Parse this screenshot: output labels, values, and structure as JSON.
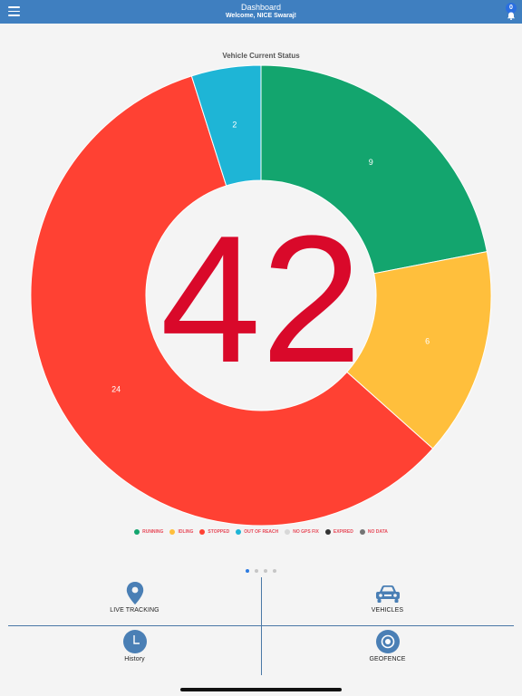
{
  "header": {
    "title": "Dashboard",
    "subtitle": "Welcome, NICE Swaraj!",
    "notification_count": "0",
    "menu_icon": "hamburger-menu-icon",
    "bell_icon": "bell-icon"
  },
  "chart_data": {
    "type": "pie",
    "title": "Vehicle Current Status",
    "total": "42",
    "categories": [
      "RUNNING",
      "IDLING",
      "STOPPED",
      "OUT OF REACH",
      "NO GPS FIX",
      "EXPIRED",
      "NO DATA"
    ],
    "values": [
      9,
      6,
      24,
      2,
      0,
      0,
      0
    ],
    "colors": [
      "#13a56e",
      "#ffbf3c",
      "#ff4133",
      "#1eb5d6",
      "#d8d8d8",
      "#333333",
      "#747474"
    ],
    "legend": "bottom",
    "center_color": "#d9092a"
  },
  "pager": {
    "count": 4,
    "active": 0
  },
  "tiles": [
    {
      "label": "LIVE TRACKING",
      "icon": "map-pin-icon"
    },
    {
      "label": "VEHICLES",
      "icon": "car-icon"
    },
    {
      "label": "History",
      "icon": "clock-icon"
    },
    {
      "label": "GEOFENCE",
      "icon": "geofence-icon"
    }
  ],
  "colors": {
    "header": "#3f7fc0",
    "tile_icon": "#4a7fb5",
    "legend_text": "#e74b5a"
  }
}
